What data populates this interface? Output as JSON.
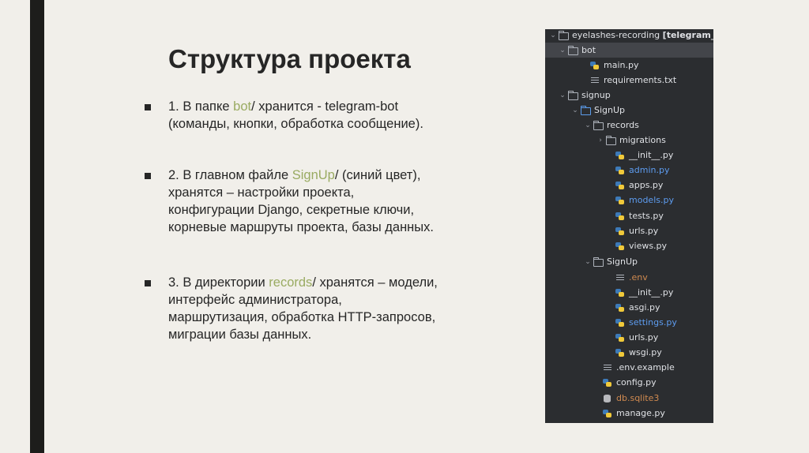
{
  "slide": {
    "title": "Структура проекта",
    "bullets": [
      {
        "pre": "1. В папке ",
        "highlight": "bot",
        "line1_rest": "/ хранится - telegram-bot",
        "lines": [
          "(команды, кнопки, обработка сообщение)."
        ]
      },
      {
        "pre": "2. В главном файле ",
        "highlight": "SignUp",
        "line1_rest": "/ (синий цвет),",
        "lines": [
          "хранятся – настройки проекта,",
          "конфигурации Django, секретные ключи,",
          "корневые маршруты проекта, базы данных."
        ]
      },
      {
        "pre": "3.  В директории ",
        "highlight": "records",
        "line1_rest": "/ хранятся – модели,",
        "lines": [
          "интерфейс администратора,",
          "маршрутизация, обработка HTTP-запросов,",
          "миграции базы данных."
        ]
      }
    ]
  },
  "tree": {
    "root": {
      "name": "eyelashes-recording",
      "branch": "[telegram_bot]"
    },
    "items": [
      {
        "label": "bot",
        "icon": "folder-icon",
        "chevron": "v"
      },
      {
        "label": "main.py",
        "icon": "python-file-icon"
      },
      {
        "label": "requirements.txt",
        "icon": "text-file-icon"
      },
      {
        "label": "signup",
        "icon": "folder-icon",
        "chevron": "v"
      },
      {
        "label": "SignUp",
        "icon": "folder-blue-icon",
        "chevron": "v"
      },
      {
        "label": "records",
        "icon": "package-folder-icon",
        "chevron": "v"
      },
      {
        "label": "migrations",
        "icon": "package-folder-icon",
        "chevron": ">"
      },
      {
        "label": "__init__.py",
        "icon": "python-file-icon"
      },
      {
        "label": "admin.py",
        "icon": "python-file-icon",
        "color": "blue"
      },
      {
        "label": "apps.py",
        "icon": "python-file-icon"
      },
      {
        "label": "models.py",
        "icon": "python-file-icon",
        "color": "blue"
      },
      {
        "label": "tests.py",
        "icon": "python-file-icon"
      },
      {
        "label": "urls.py",
        "icon": "python-file-icon"
      },
      {
        "label": "views.py",
        "icon": "python-file-icon"
      },
      {
        "label": "SignUp",
        "icon": "package-folder-icon",
        "chevron": "v"
      },
      {
        "label": ".env",
        "icon": "text-file-icon",
        "color": "orange"
      },
      {
        "label": "__init__.py",
        "icon": "python-file-icon"
      },
      {
        "label": "asgi.py",
        "icon": "python-file-icon"
      },
      {
        "label": "settings.py",
        "icon": "python-file-icon",
        "color": "blue"
      },
      {
        "label": "urls.py",
        "icon": "python-file-icon"
      },
      {
        "label": "wsgi.py",
        "icon": "python-file-icon"
      },
      {
        "label": ".env.example",
        "icon": "text-file-icon"
      },
      {
        "label": "config.py",
        "icon": "python-file-icon"
      },
      {
        "label": "db.sqlite3",
        "icon": "database-icon",
        "color": "orange"
      },
      {
        "label": "manage.py",
        "icon": "python-file-icon"
      }
    ]
  },
  "colors": {
    "highlight": "#9aab62",
    "tree_bg": "#2b2d30",
    "accent_bar": "#1d1d1b"
  }
}
